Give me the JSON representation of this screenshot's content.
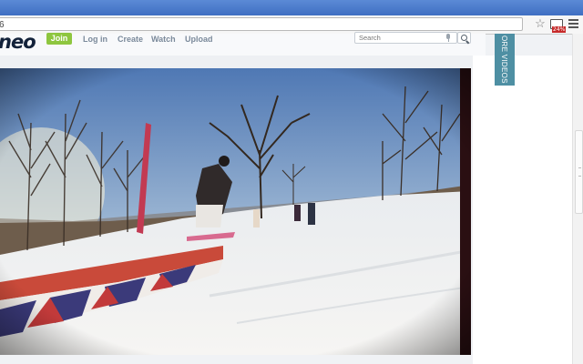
{
  "browser": {
    "url": "6",
    "extension_badge": "24%"
  },
  "site": {
    "logo": "neo",
    "join_label": "Join",
    "nav": [
      "Log in",
      "Create",
      "Watch",
      "Upload"
    ],
    "search_placeholder": "Search",
    "more_videos_label": "ORE VIDEOS"
  },
  "icons": {
    "star": "bookmark-star-icon",
    "extension": "extension-icon",
    "menu": "hamburger-menu-icon",
    "mic": "microphone-icon",
    "search": "magnifier-icon"
  },
  "colors": {
    "chrome_blue": "#4a7bcc",
    "join_green": "#8ec63f",
    "more_videos_teal": "#4e8fa3",
    "nav_gray": "#7b8a9b",
    "logo_navy": "#13223a"
  }
}
